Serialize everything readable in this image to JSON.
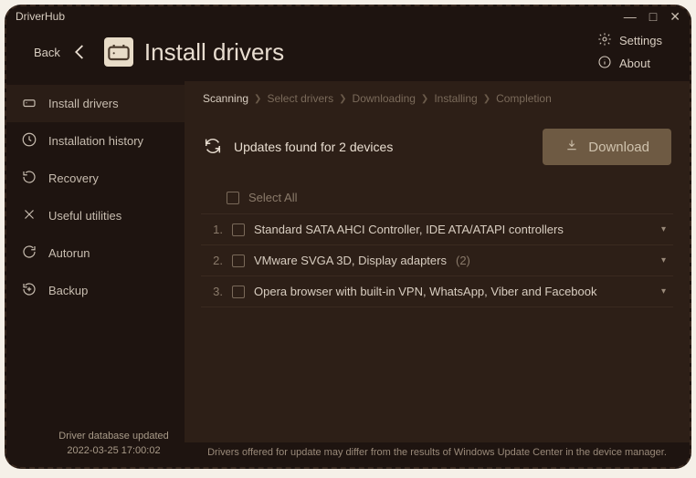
{
  "app": {
    "title": "DriverHub"
  },
  "window": {
    "min": "—",
    "max": "□",
    "close": "✕"
  },
  "header": {
    "back_label": "Back",
    "page_title": "Install drivers",
    "settings_label": "Settings",
    "about_label": "About"
  },
  "sidebar": {
    "items": [
      {
        "label": "Install drivers"
      },
      {
        "label": "Installation history"
      },
      {
        "label": "Recovery"
      },
      {
        "label": "Useful utilities"
      },
      {
        "label": "Autorun"
      },
      {
        "label": "Backup"
      }
    ]
  },
  "breadcrumb": {
    "items": [
      {
        "label": "Scanning",
        "active": true
      },
      {
        "label": "Select drivers"
      },
      {
        "label": "Downloading"
      },
      {
        "label": "Installing"
      },
      {
        "label": "Completion"
      }
    ]
  },
  "updates": {
    "text": "Updates found for 2 devices",
    "download_label": "Download"
  },
  "list": {
    "select_all_label": "Select All",
    "rows": [
      {
        "num": "1.",
        "label": "Standard SATA AHCI Controller, IDE ATA/ATAPI controllers",
        "count": ""
      },
      {
        "num": "2.",
        "label": "VMware SVGA 3D, Display adapters",
        "count": "(2)"
      },
      {
        "num": "3.",
        "label": "Opera browser with built-in VPN, WhatsApp, Viber and Facebook",
        "count": ""
      }
    ]
  },
  "footer": {
    "db_label": "Driver database updated",
    "db_date": "2022-03-25 17:00:02",
    "disclaimer": "Drivers offered for update may differ from the results of Windows Update Center in the device manager."
  }
}
